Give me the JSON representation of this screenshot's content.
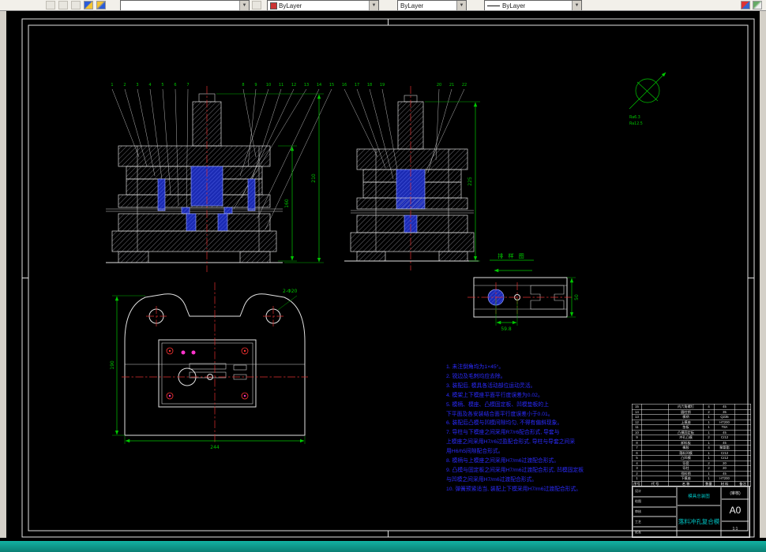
{
  "toolbar": {
    "layer_value": "",
    "color_value": "ByLayer",
    "linetype_value": "ByLayer",
    "lineweight_value": "ByLayer"
  },
  "notes": {
    "lines": [
      "1. 未注倒角均为1×45°。",
      "2. 锐边及毛刺均应去除。",
      "3. 装配后, 模具各活动部位运动灵活。",
      "4. 模架上下模座平面平行度误差为0.02。",
      "5. 模柄、模座、凸模固定板、凹模垫板的上",
      "   下平面及各安装结合面平行度误差小于0.01。",
      "6. 装配后凸模与凹模间隙均匀, 不得有偏斜现象。",
      "7. 导柱与下模座之间采用R7/r6配合形式, 导套与",
      "   上模座之间采用H7/r6过盈配合形式, 导柱与导套之间采",
      "   用H6/h5间隙配合形式。",
      "8. 模柄与上模座之间采用H7/m6过渡配合形式。",
      "9. 凸模与固定板之间采用H7/m6过渡配合形式, 凹模固定板",
      "   与凹模之间采用H7/m6过渡配合形式。",
      "10. 弹簧预紧适当, 装配上下模采用H7/m6过渡配合形式。"
    ]
  },
  "balloons": [
    "1",
    "2",
    "3",
    "4",
    "5",
    "6",
    "7",
    "8",
    "9",
    "10",
    "11",
    "12",
    "13",
    "14",
    "15",
    "16",
    "17",
    "18",
    "19",
    "20",
    "21",
    "22"
  ],
  "dims": {
    "left_h1": "160",
    "left_h2": "210",
    "right_h": "225",
    "plan_w": "244",
    "plan_h": "190",
    "plan_holes": "2-Φ20",
    "strip_pitch": "59.8",
    "strip_w": "50"
  },
  "strip": {
    "label": "排 样 图"
  },
  "roughness": {
    "line1": "Ra6.3",
    "line2": "Ra12.5"
  },
  "title_block": {
    "header_cols": [
      "序号",
      "代 号",
      "名 称",
      "数量",
      "材 料",
      "备注"
    ],
    "rows": [
      {
        "no": "15",
        "code": "",
        "name": "内六角螺钉",
        "qty": "4",
        "mat": "45",
        "note": ""
      },
      {
        "no": "14",
        "code": "",
        "name": "圆柱销",
        "qty": "2",
        "mat": "35",
        "note": ""
      },
      {
        "no": "13",
        "code": "",
        "name": "模柄",
        "qty": "1",
        "mat": "Q235",
        "note": ""
      },
      {
        "no": "12",
        "code": "",
        "name": "上模座",
        "qty": "1",
        "mat": "HT200",
        "note": ""
      },
      {
        "no": "11",
        "code": "",
        "name": "垫板",
        "qty": "1",
        "mat": "T8A",
        "note": ""
      },
      {
        "no": "10",
        "code": "",
        "name": "凸模固定板",
        "qty": "1",
        "mat": "45",
        "note": ""
      },
      {
        "no": "9",
        "code": "",
        "name": "冲孔凸模",
        "qty": "2",
        "mat": "Cr12",
        "note": ""
      },
      {
        "no": "8",
        "code": "",
        "name": "卸料板",
        "qty": "1",
        "mat": "45",
        "note": ""
      },
      {
        "no": "7",
        "code": "",
        "name": "橡胶",
        "qty": "4",
        "mat": "聚氨酯",
        "note": ""
      },
      {
        "no": "6",
        "code": "",
        "name": "落料凹模",
        "qty": "1",
        "mat": "Cr12",
        "note": ""
      },
      {
        "no": "5",
        "code": "",
        "name": "凸凹模",
        "qty": "1",
        "mat": "Cr12",
        "note": ""
      },
      {
        "no": "4",
        "code": "",
        "name": "导套",
        "qty": "2",
        "mat": "20",
        "note": ""
      },
      {
        "no": "3",
        "code": "",
        "name": "导柱",
        "qty": "2",
        "mat": "20",
        "note": ""
      },
      {
        "no": "2",
        "code": "",
        "name": "挡料销",
        "qty": "1",
        "mat": "45",
        "note": ""
      },
      {
        "no": "1",
        "code": "",
        "name": "下模座",
        "qty": "1",
        "mat": "HT200",
        "note": ""
      }
    ],
    "sign_rows": [
      "设计",
      "绘图",
      "审核",
      "工艺",
      "批准"
    ],
    "subtitle": "模具总装图",
    "drawing_title": "落料冲孔复合模",
    "paren_label": "(审核)",
    "sheet_size": "A0",
    "scale": "1:1"
  }
}
